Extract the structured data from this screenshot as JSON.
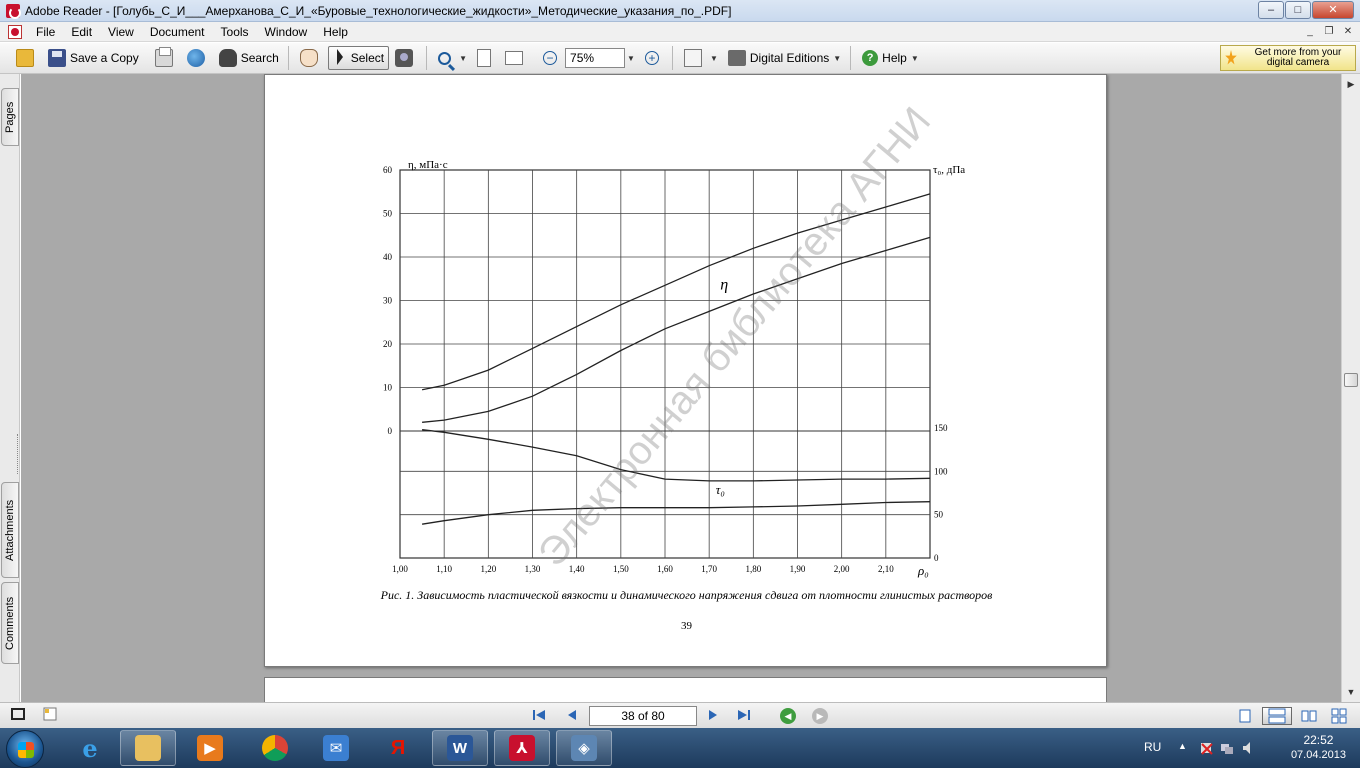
{
  "window": {
    "title": "Adobe Reader - [Голубь_С_И___Амерханова_С_И_«Буровые_технологические_жидкости»_Методические_указания_по_.PDF]",
    "minimize": "–",
    "maximize": "□",
    "close": "✕"
  },
  "menu": {
    "items": [
      "File",
      "Edit",
      "View",
      "Document",
      "Tools",
      "Window",
      "Help"
    ]
  },
  "doc_controls": {
    "minimize": "_",
    "restore": "❐",
    "close": "✕"
  },
  "toolbar": {
    "save_copy": "Save a Copy",
    "search": "Search",
    "select": "Select",
    "zoom_value": "75%",
    "digital_editions": "Digital Editions",
    "help": "Help",
    "promo": "Get more from your digital camera"
  },
  "navpane": {
    "tabs": [
      "Pages",
      "Attachments",
      "Comments"
    ]
  },
  "page": {
    "caption": "Рис. 1. Зависимость пластической вязкости и динамического напряжения сдвига от плотности глинистых растворов",
    "page_number": "39",
    "watermark": "Электронная библиотека АГНИ"
  },
  "chart_data": {
    "type": "line",
    "left_axis_label": "η, мПа·с",
    "right_axis_label": "τ₀, дПа",
    "x_axis_label": "ρ₀",
    "x_ticks": [
      "1,00",
      "1,10",
      "1,20",
      "1,30",
      "1,40",
      "1,50",
      "1,60",
      "1,70",
      "1,80",
      "1,90",
      "2,00",
      "2,10"
    ],
    "xlim": [
      1.0,
      2.2
    ],
    "left_ticks": [
      "60",
      "50",
      "40",
      "30",
      "20",
      "10",
      "0"
    ],
    "right_ticks": [
      "150",
      "100",
      "50",
      "0"
    ],
    "left_ylim": [
      0,
      60
    ],
    "right_ylim": [
      0,
      150
    ],
    "curve_labels": [
      "η",
      "τ₀"
    ],
    "series": [
      {
        "name": "η",
        "axis": "left",
        "x": [
          1.05,
          1.1,
          1.2,
          1.3,
          1.4,
          1.5,
          1.6,
          1.7,
          1.8,
          1.9,
          2.0,
          2.1,
          2.2
        ],
        "y": [
          9.5,
          10.5,
          14,
          19,
          24,
          29,
          33.5,
          38,
          42,
          45.5,
          48.5,
          51.5,
          54.5
        ]
      },
      {
        "name": "η",
        "axis": "left",
        "x": [
          1.05,
          1.1,
          1.2,
          1.3,
          1.4,
          1.5,
          1.6,
          1.7,
          1.8,
          1.9,
          2.0,
          2.1,
          2.2
        ],
        "y": [
          2,
          2.5,
          4.5,
          8,
          13,
          18.5,
          23.5,
          27.5,
          31.5,
          35,
          38.5,
          41.5,
          44.5
        ]
      },
      {
        "name": "τ₀",
        "axis": "right",
        "x": [
          1.05,
          1.1,
          1.2,
          1.3,
          1.4,
          1.5,
          1.6,
          1.7,
          1.8,
          1.9,
          2.0,
          2.1,
          2.2
        ],
        "y": [
          148,
          145,
          137,
          128,
          118,
          102,
          91,
          89,
          89,
          90,
          91,
          91,
          92
        ]
      },
      {
        "name": "τ₀",
        "axis": "right",
        "x": [
          1.05,
          1.1,
          1.2,
          1.3,
          1.4,
          1.5,
          1.6,
          1.7,
          1.8,
          1.9,
          2.0,
          2.1,
          2.2
        ],
        "y": [
          39,
          43,
          50,
          55,
          57,
          58,
          58,
          58,
          59,
          60,
          62,
          64,
          65
        ]
      }
    ]
  },
  "statusbar": {
    "page_field": "38 of 80"
  },
  "taskbar": {
    "lang": "RU",
    "time": "22:52",
    "date": "07.04.2013"
  }
}
